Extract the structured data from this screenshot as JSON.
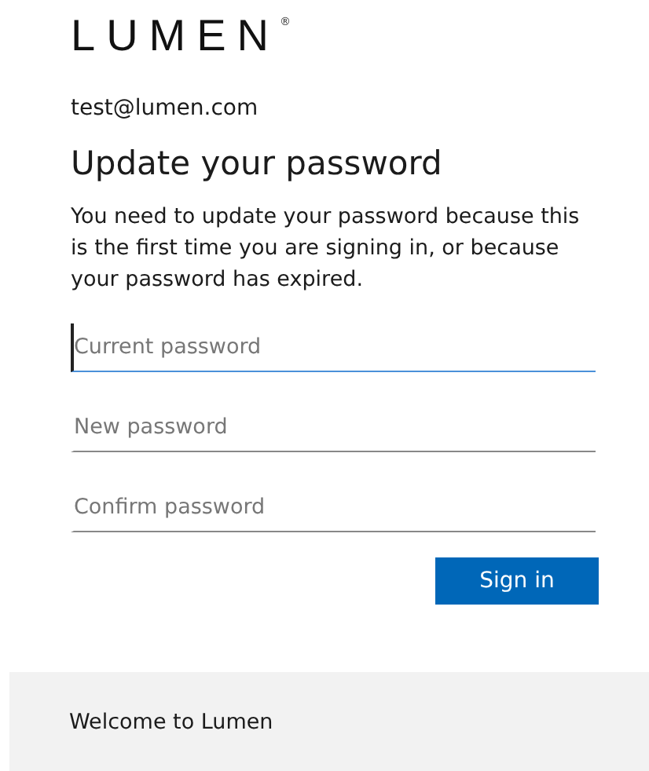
{
  "logo": {
    "text": "LUMEN",
    "mark": "®"
  },
  "account": "test@lumen.com",
  "title": "Update your password",
  "description": "You need to update your password because this is the first time you are signing in, or because your password has expired.",
  "fields": [
    {
      "placeholder": "Current password",
      "focused": true
    },
    {
      "placeholder": "New password",
      "focused": false
    },
    {
      "placeholder": "Confirm password",
      "focused": false
    }
  ],
  "submit": "Sign in",
  "footer": "Welcome to Lumen"
}
